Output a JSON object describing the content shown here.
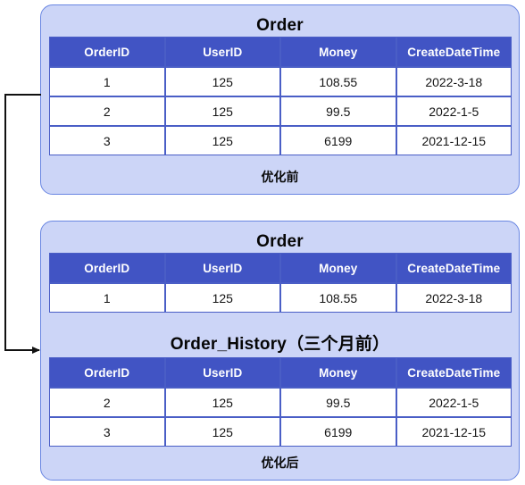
{
  "diagram": {
    "columns": [
      "OrderID",
      "UserID",
      "Money",
      "CreateDateTime"
    ],
    "arrow": {
      "label": "",
      "icon": "arrow-right-icon",
      "stroke_color": "#111111"
    },
    "colors": {
      "panel_background": "#ccd5f7",
      "panel_border": "#6986e2",
      "table_header_background": "#4154c4",
      "table_header_text": "#ffffff",
      "table_cell_background": "#ffffff",
      "table_cell_border": "#4a5ec6",
      "title_text": "#060606"
    },
    "before": {
      "caption": "优化前",
      "table": {
        "title": "Order",
        "columns": [
          "OrderID",
          "UserID",
          "Money",
          "CreateDateTime"
        ],
        "rows": [
          {
            "order_id": "1",
            "user_id": "125",
            "money": "108.55",
            "create_date_time": "2022-3-18"
          },
          {
            "order_id": "2",
            "user_id": "125",
            "money": "99.5",
            "create_date_time": "2022-1-5"
          },
          {
            "order_id": "3",
            "user_id": "125",
            "money": "6199",
            "create_date_time": "2021-12-15"
          }
        ]
      }
    },
    "after": {
      "caption": "优化后",
      "order_table": {
        "title": "Order",
        "columns": [
          "OrderID",
          "UserID",
          "Money",
          "CreateDateTime"
        ],
        "rows": [
          {
            "order_id": "1",
            "user_id": "125",
            "money": "108.55",
            "create_date_time": "2022-3-18"
          }
        ]
      },
      "history_table": {
        "title": "Order_History（三个月前）",
        "columns": [
          "OrderID",
          "UserID",
          "Money",
          "CreateDateTime"
        ],
        "rows": [
          {
            "order_id": "2",
            "user_id": "125",
            "money": "99.5",
            "create_date_time": "2022-1-5"
          },
          {
            "order_id": "3",
            "user_id": "125",
            "money": "6199",
            "create_date_time": "2021-12-15"
          }
        ]
      }
    }
  }
}
